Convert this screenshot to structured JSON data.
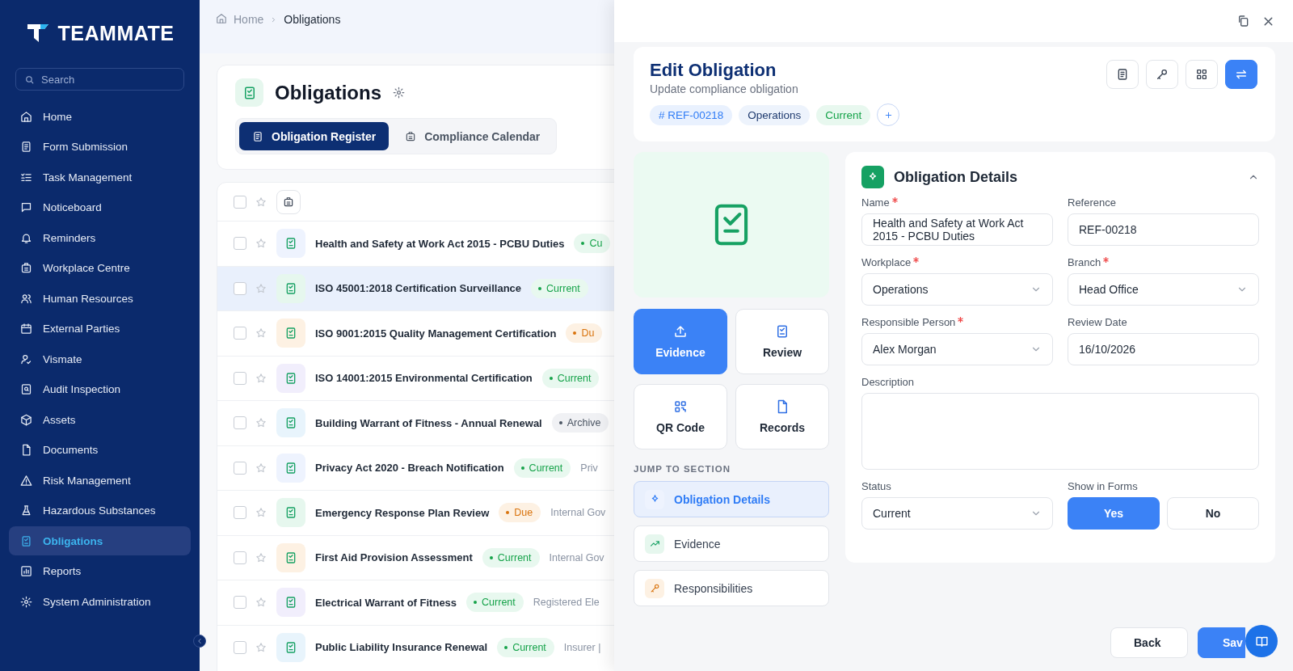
{
  "sidebar": {
    "logo": "TEAMMATE",
    "search": {
      "placeholder": "Search"
    },
    "items": [
      {
        "label": "Home",
        "selected": false
      },
      {
        "label": "Form Submission",
        "selected": false
      },
      {
        "label": "Task Management",
        "selected": false
      },
      {
        "label": "Noticeboard",
        "selected": false
      },
      {
        "label": "Reminders",
        "selected": false
      },
      {
        "label": "Workplace Centre",
        "selected": false
      },
      {
        "label": "Human Resources",
        "selected": false
      },
      {
        "label": "External Parties",
        "selected": false
      },
      {
        "label": "Vismate",
        "selected": false
      },
      {
        "label": "Audit Inspection",
        "selected": false
      },
      {
        "label": "Assets",
        "selected": false
      },
      {
        "label": "Documents",
        "selected": false
      },
      {
        "label": "Risk Management",
        "selected": false
      },
      {
        "label": "Hazardous Substances",
        "selected": false
      },
      {
        "label": "Obligations",
        "selected": true
      },
      {
        "label": "Reports",
        "selected": false
      },
      {
        "label": "System Administration",
        "selected": false
      }
    ]
  },
  "breadcrumb": [
    "Home",
    "Obligations"
  ],
  "page": {
    "title": "Obligations",
    "tabs": [
      {
        "label": "Obligation Register",
        "selected": true
      },
      {
        "label": "Compliance Calendar",
        "selected": false
      }
    ]
  },
  "list": {
    "header": {
      "checked": false,
      "starred": false
    },
    "rows": [
      {
        "title": "Health and Safety at Work Act 2015 - PCBU Duties",
        "status": {
          "label": "Cu",
          "kind": "current"
        },
        "detail": "",
        "color": "#eef3fe",
        "checked": false,
        "starred": false,
        "selected": false
      },
      {
        "title": "ISO 45001:2018 Certification Surveillance",
        "status": {
          "label": "Current",
          "kind": "current"
        },
        "detail": "",
        "color": "#e6f7ee",
        "checked": false,
        "starred": false,
        "selected": true
      },
      {
        "title": "ISO 9001:2015 Quality Management Certification",
        "status": {
          "label": "Du",
          "kind": "due"
        },
        "detail": "",
        "color": "#fdf1e3",
        "checked": false,
        "starred": false,
        "selected": false
      },
      {
        "title": "ISO 14001:2015 Environmental Certification",
        "status": {
          "label": "Current",
          "kind": "current"
        },
        "detail": "",
        "color": "#f1eefc",
        "checked": false,
        "starred": false,
        "selected": false
      },
      {
        "title": "Building Warrant of Fitness - Annual Renewal",
        "status": {
          "label": "Archive",
          "kind": "archived"
        },
        "detail": "",
        "color": "#e8f4fc",
        "checked": false,
        "starred": false,
        "selected": false
      },
      {
        "title": "Privacy Act 2020 - Breach Notification",
        "status": {
          "label": "Current",
          "kind": "current"
        },
        "detail": "Priv",
        "color": "#eef3fe",
        "checked": false,
        "starred": false,
        "selected": false
      },
      {
        "title": "Emergency Response Plan Review",
        "status": {
          "label": "Due",
          "kind": "due"
        },
        "detail": "Internal Gov",
        "color": "#e6f7ee",
        "checked": false,
        "starred": false,
        "selected": false
      },
      {
        "title": "First Aid Provision Assessment",
        "status": {
          "label": "Current",
          "kind": "current"
        },
        "detail": "Internal Gov",
        "color": "#fdf1e3",
        "checked": false,
        "starred": false,
        "selected": false
      },
      {
        "title": "Electrical Warrant of Fitness",
        "status": {
          "label": "Current",
          "kind": "current"
        },
        "detail": "Registered Ele",
        "color": "#f1eefc",
        "checked": false,
        "starred": false,
        "selected": false
      },
      {
        "title": "Public Liability Insurance Renewal",
        "status": {
          "label": "Current",
          "kind": "current"
        },
        "detail": "Insurer |",
        "color": "#e8f4fc",
        "checked": false,
        "starred": false,
        "selected": false
      }
    ]
  },
  "drawer": {
    "title": "Edit Obligation",
    "subtitle": "Update compliance obligation",
    "tags": [
      {
        "label": "# REF-00218",
        "kind": "ref"
      },
      {
        "label": "Operations",
        "kind": "branch"
      },
      {
        "label": "Current",
        "kind": "status"
      }
    ],
    "view_buttons": [
      {
        "selected": false
      },
      {
        "selected": false
      },
      {
        "selected": false
      },
      {
        "selected": true
      }
    ],
    "actions": [
      {
        "label": "Evidence",
        "selected": true
      },
      {
        "label": "Review",
        "selected": false
      },
      {
        "label": "QR Code",
        "selected": false
      },
      {
        "label": "Records",
        "selected": false
      }
    ],
    "jump_label": "JUMP TO SECTION",
    "sections": [
      {
        "label": "Obligation Details",
        "selected": true,
        "color": "#eef3fe"
      },
      {
        "label": "Evidence",
        "selected": false,
        "color": "#e6f7ee"
      },
      {
        "label": "Responsibilities",
        "selected": false,
        "color": "#fdf1e3"
      }
    ],
    "details": {
      "title": "Obligation Details",
      "expanded": true,
      "fields": [
        {
          "label": "Name",
          "required": true,
          "kind": "textarea",
          "value": "Health and Safety at Work Act 2015 - PCBU Duties"
        },
        {
          "label": "Reference",
          "required": false,
          "kind": "text",
          "value": "REF-00218"
        },
        {
          "label": "Workplace",
          "required": true,
          "kind": "select",
          "value": "Operations"
        },
        {
          "label": "Branch",
          "required": true,
          "kind": "select",
          "value": "Head Office"
        },
        {
          "label": "Responsible Person",
          "required": true,
          "kind": "select",
          "value": "Alex Morgan"
        },
        {
          "label": "Review Date",
          "required": false,
          "kind": "text",
          "value": "16/10/2026"
        },
        {
          "label": "Description",
          "required": false,
          "kind": "description"
        },
        {
          "label": "Status",
          "required": false,
          "kind": "select",
          "value": "Current"
        },
        {
          "label": "Show in Forms",
          "required": false,
          "kind": "toggle",
          "options": [
            {
              "label": "Yes",
              "selected": true
            },
            {
              "label": "No",
              "selected": false
            }
          ]
        }
      ]
    },
    "buttons": [
      "Back",
      "Sav"
    ]
  }
}
